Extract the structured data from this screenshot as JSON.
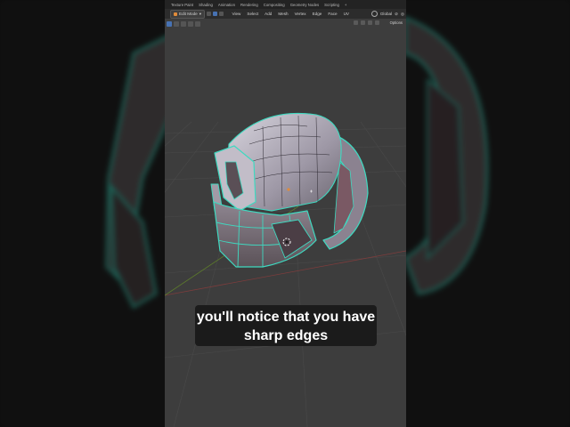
{
  "workspace_tabs": [
    "Texture Paint",
    "Shading",
    "Animation",
    "Rendering",
    "Compositing",
    "Geometry Nodes",
    "Scripting",
    "+"
  ],
  "header": {
    "mode_label": "Edit Mode",
    "menus": [
      "View",
      "Select",
      "Add",
      "Mesh",
      "Vertex",
      "Edge",
      "Face",
      "UV"
    ],
    "transform_orientation": "Global"
  },
  "tool_header": {
    "options_label": "Options"
  },
  "caption": {
    "line1": "you'll notice that you have",
    "line2": "sharp edges"
  },
  "colors": {
    "wire_highlight": "#3fd9c0",
    "mesh_surface": "#b7b3bf",
    "viewport_bg": "#3d3d3d"
  },
  "icons": [
    "editmode-icon",
    "vertex-select-icon",
    "edge-select-icon",
    "face-select-icon",
    "snap-icon",
    "proportional-edit-icon",
    "3d-cursor-icon"
  ]
}
